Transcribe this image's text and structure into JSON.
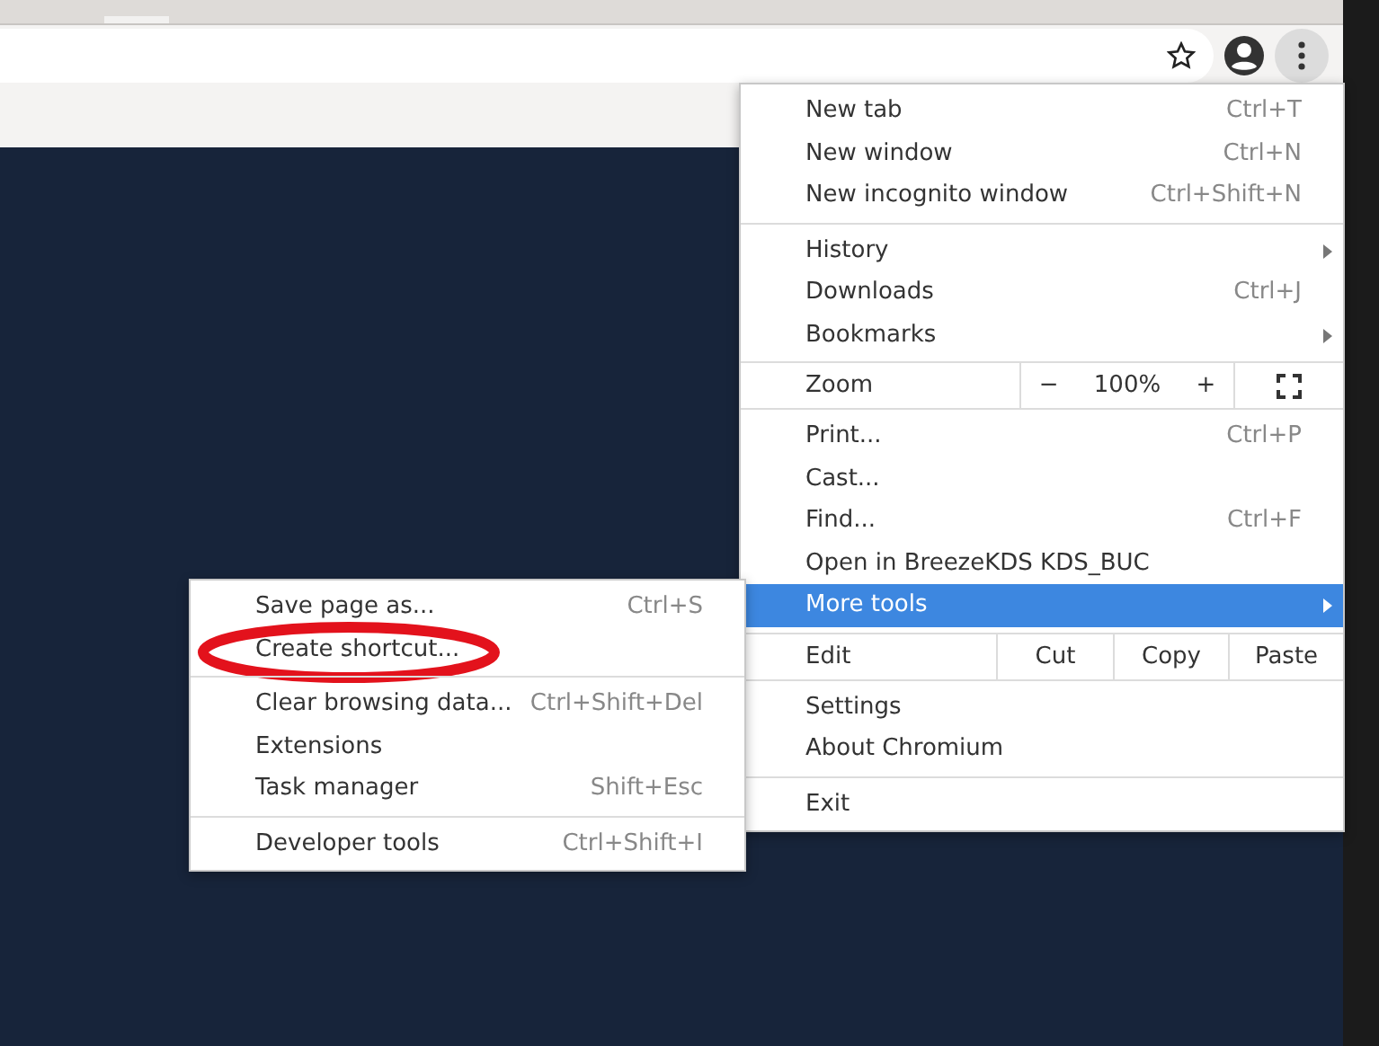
{
  "toolbar": {
    "menu_button_pressed": true
  },
  "main_menu": {
    "sections": [
      [
        {
          "kind": "command",
          "label": "New tab",
          "shortcut": "Ctrl+T",
          "submenu": false,
          "selected": false
        },
        {
          "kind": "command",
          "label": "New window",
          "shortcut": "Ctrl+N",
          "submenu": false,
          "selected": false
        },
        {
          "kind": "command",
          "label": "New incognito window",
          "shortcut": "Ctrl+Shift+N",
          "submenu": false,
          "selected": false
        }
      ],
      [
        {
          "kind": "command",
          "label": "History",
          "submenu": true,
          "selected": false
        },
        {
          "kind": "command",
          "label": "Downloads",
          "shortcut": "Ctrl+J",
          "submenu": false,
          "selected": false
        },
        {
          "kind": "command",
          "label": "Bookmarks",
          "submenu": true,
          "selected": false
        }
      ],
      [
        {
          "kind": "zoom",
          "label": "Zoom",
          "minus": "−",
          "value": "100%",
          "plus": "+"
        }
      ],
      [
        {
          "kind": "command",
          "label": "Print...",
          "shortcut": "Ctrl+P",
          "submenu": false,
          "selected": false
        },
        {
          "kind": "command",
          "label": "Cast...",
          "submenu": false,
          "selected": false
        },
        {
          "kind": "command",
          "label": "Find...",
          "shortcut": "Ctrl+F",
          "submenu": false,
          "selected": false
        },
        {
          "kind": "command",
          "label": "Open in BreezeKDS KDS_BUC",
          "submenu": false,
          "selected": false
        },
        {
          "kind": "command",
          "label": "More tools",
          "submenu": true,
          "selected": true
        }
      ],
      [
        {
          "kind": "edit",
          "label": "Edit",
          "buttons": [
            "Cut",
            "Copy",
            "Paste"
          ]
        }
      ],
      [
        {
          "kind": "command",
          "label": "Settings",
          "submenu": false,
          "selected": false
        },
        {
          "kind": "command",
          "label": "About Chromium",
          "submenu": false,
          "selected": false
        }
      ],
      [
        {
          "kind": "command",
          "label": "Exit",
          "submenu": false,
          "selected": false
        }
      ]
    ]
  },
  "more_tools_menu": {
    "sections": [
      [
        {
          "label": "Save page as...",
          "shortcut": "Ctrl+S",
          "circled": false
        },
        {
          "label": "Create shortcut...",
          "circled": true
        }
      ],
      [
        {
          "label": "Clear browsing data...",
          "shortcut": "Ctrl+Shift+Del",
          "circled": false
        },
        {
          "label": "Extensions",
          "circled": false
        },
        {
          "label": "Task manager",
          "shortcut": "Shift+Esc",
          "circled": false
        }
      ],
      [
        {
          "label": "Developer tools",
          "shortcut": "Ctrl+Shift+I",
          "circled": false
        }
      ]
    ]
  }
}
